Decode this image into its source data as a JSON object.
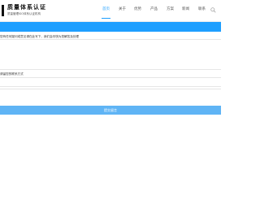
{
  "brand": {
    "title": "质量体系认证",
    "subtitle": "质量管理ISO体系认证机构"
  },
  "nav": {
    "items": [
      "首页",
      "关于",
      "优势",
      "产品",
      "方案",
      "新闻",
      "联系"
    ],
    "active_index": 0
  },
  "form": {
    "prompt": "您有任何疑问或意见请在此写下，我们会尽快为您解答及处理",
    "contact_label": "请留您的联系方式",
    "submit_label": "提交留言"
  },
  "colors": {
    "accent": "#1e9fff",
    "submit_bg": "#5fb4f5"
  },
  "icons": {
    "search": "search-icon"
  }
}
